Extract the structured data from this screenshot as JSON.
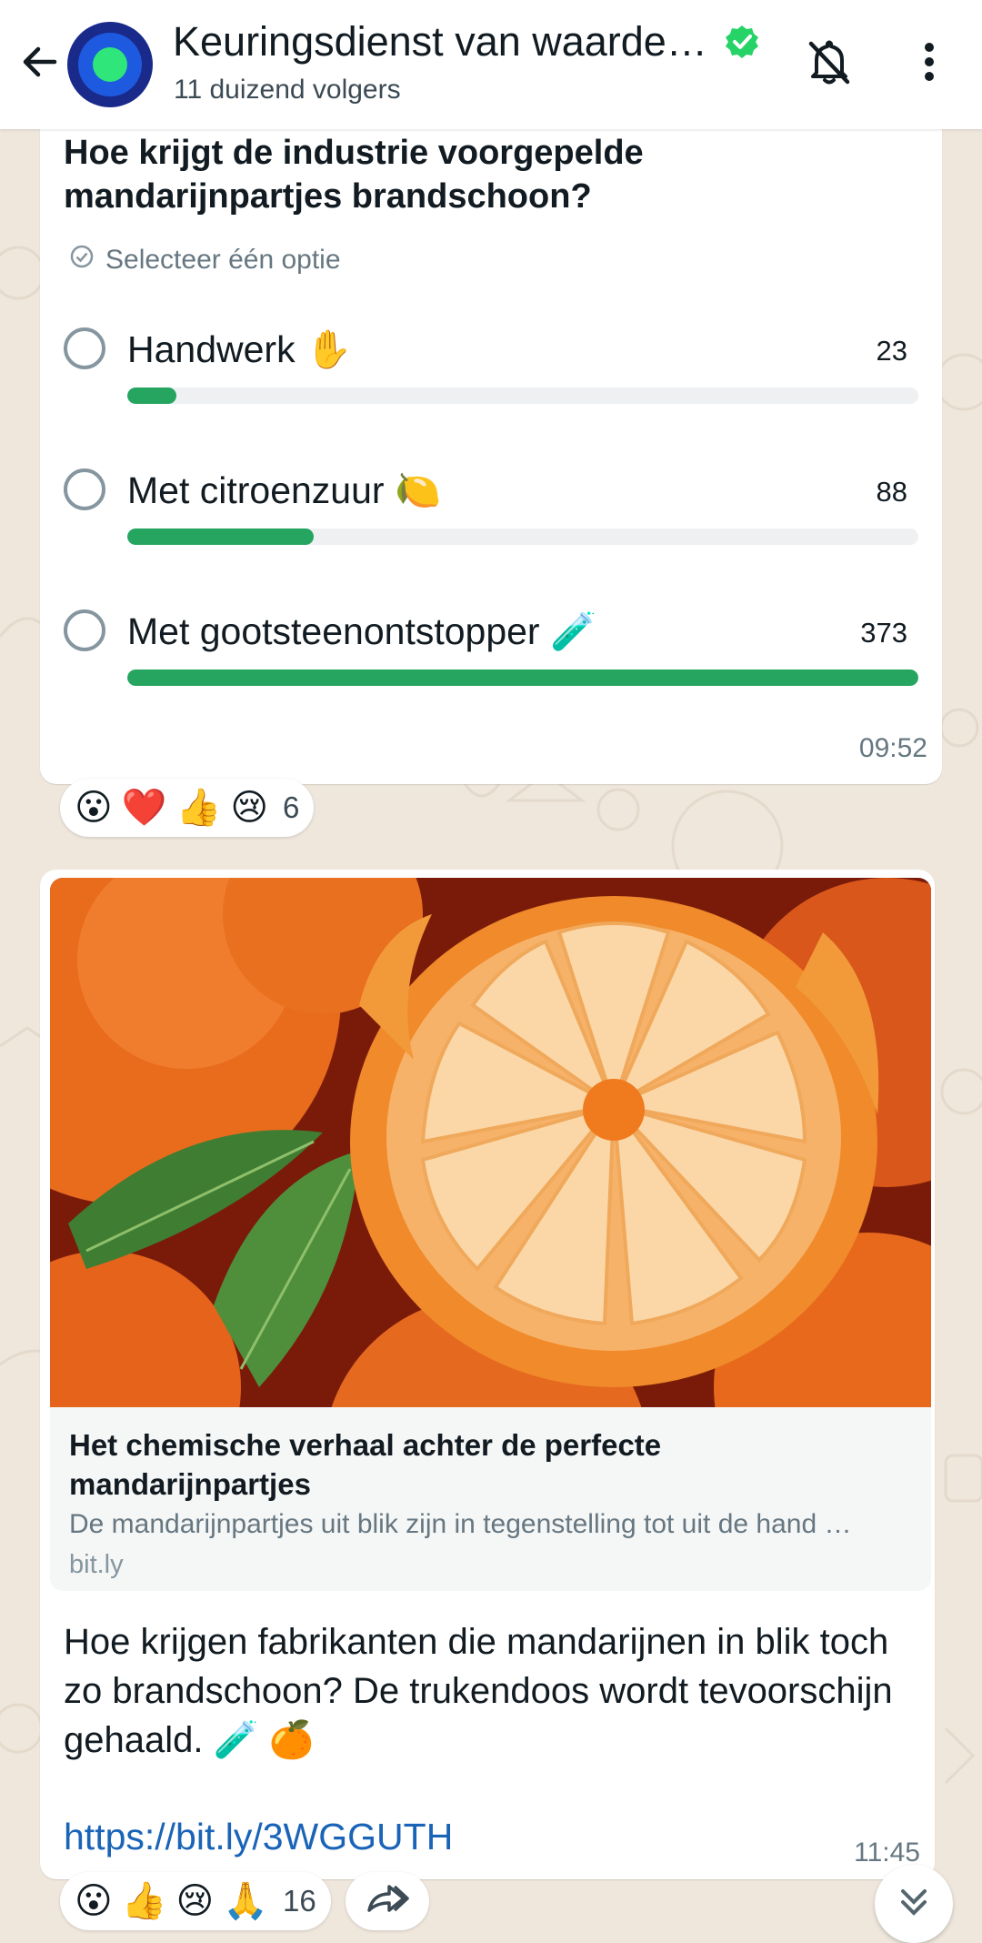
{
  "header": {
    "channel_name": "Keuringsdienst van waarde…",
    "followers": "11 duizend volgers"
  },
  "poll": {
    "question": "Hoe krijgt de industrie voorgepelde mandarijnpartjes brandschoon?",
    "hint": "Selecteer één optie",
    "options": [
      {
        "label": "Handwerk ✋",
        "votes": "23",
        "share": 0.062
      },
      {
        "label": "Met citroenzuur 🍋",
        "votes": "88",
        "share": 0.236
      },
      {
        "label": "Met gootsteenontstopper 🧪",
        "votes": "373",
        "share": 1.0
      }
    ],
    "time": "09:52",
    "reactions": {
      "emojis": [
        "😮",
        "❤️",
        "👍",
        "😢"
      ],
      "count": "6"
    }
  },
  "message": {
    "preview_title": "Het chemische verhaal achter de perfecte mandarijnpartjes",
    "preview_description": "De mandarijnpartjes uit blik zijn in tegenstelling tot uit de hand …",
    "preview_domain": "bit.ly",
    "text": "Hoe krijgen fabrikanten die mandarijnen in blik toch zo brandschoon? De trukendoos wordt tevoorschijn gehaald. 🧪 🍊",
    "link": "https://bit.ly/3WGGUTH",
    "time": "11:45",
    "reactions": {
      "emojis": [
        "😮",
        "👍",
        "😢",
        "🙏"
      ],
      "count": "16"
    }
  },
  "colors": {
    "accent_green": "#25a55f",
    "link_blue": "#1a64b8",
    "wallpaper": "#efe7dc"
  }
}
